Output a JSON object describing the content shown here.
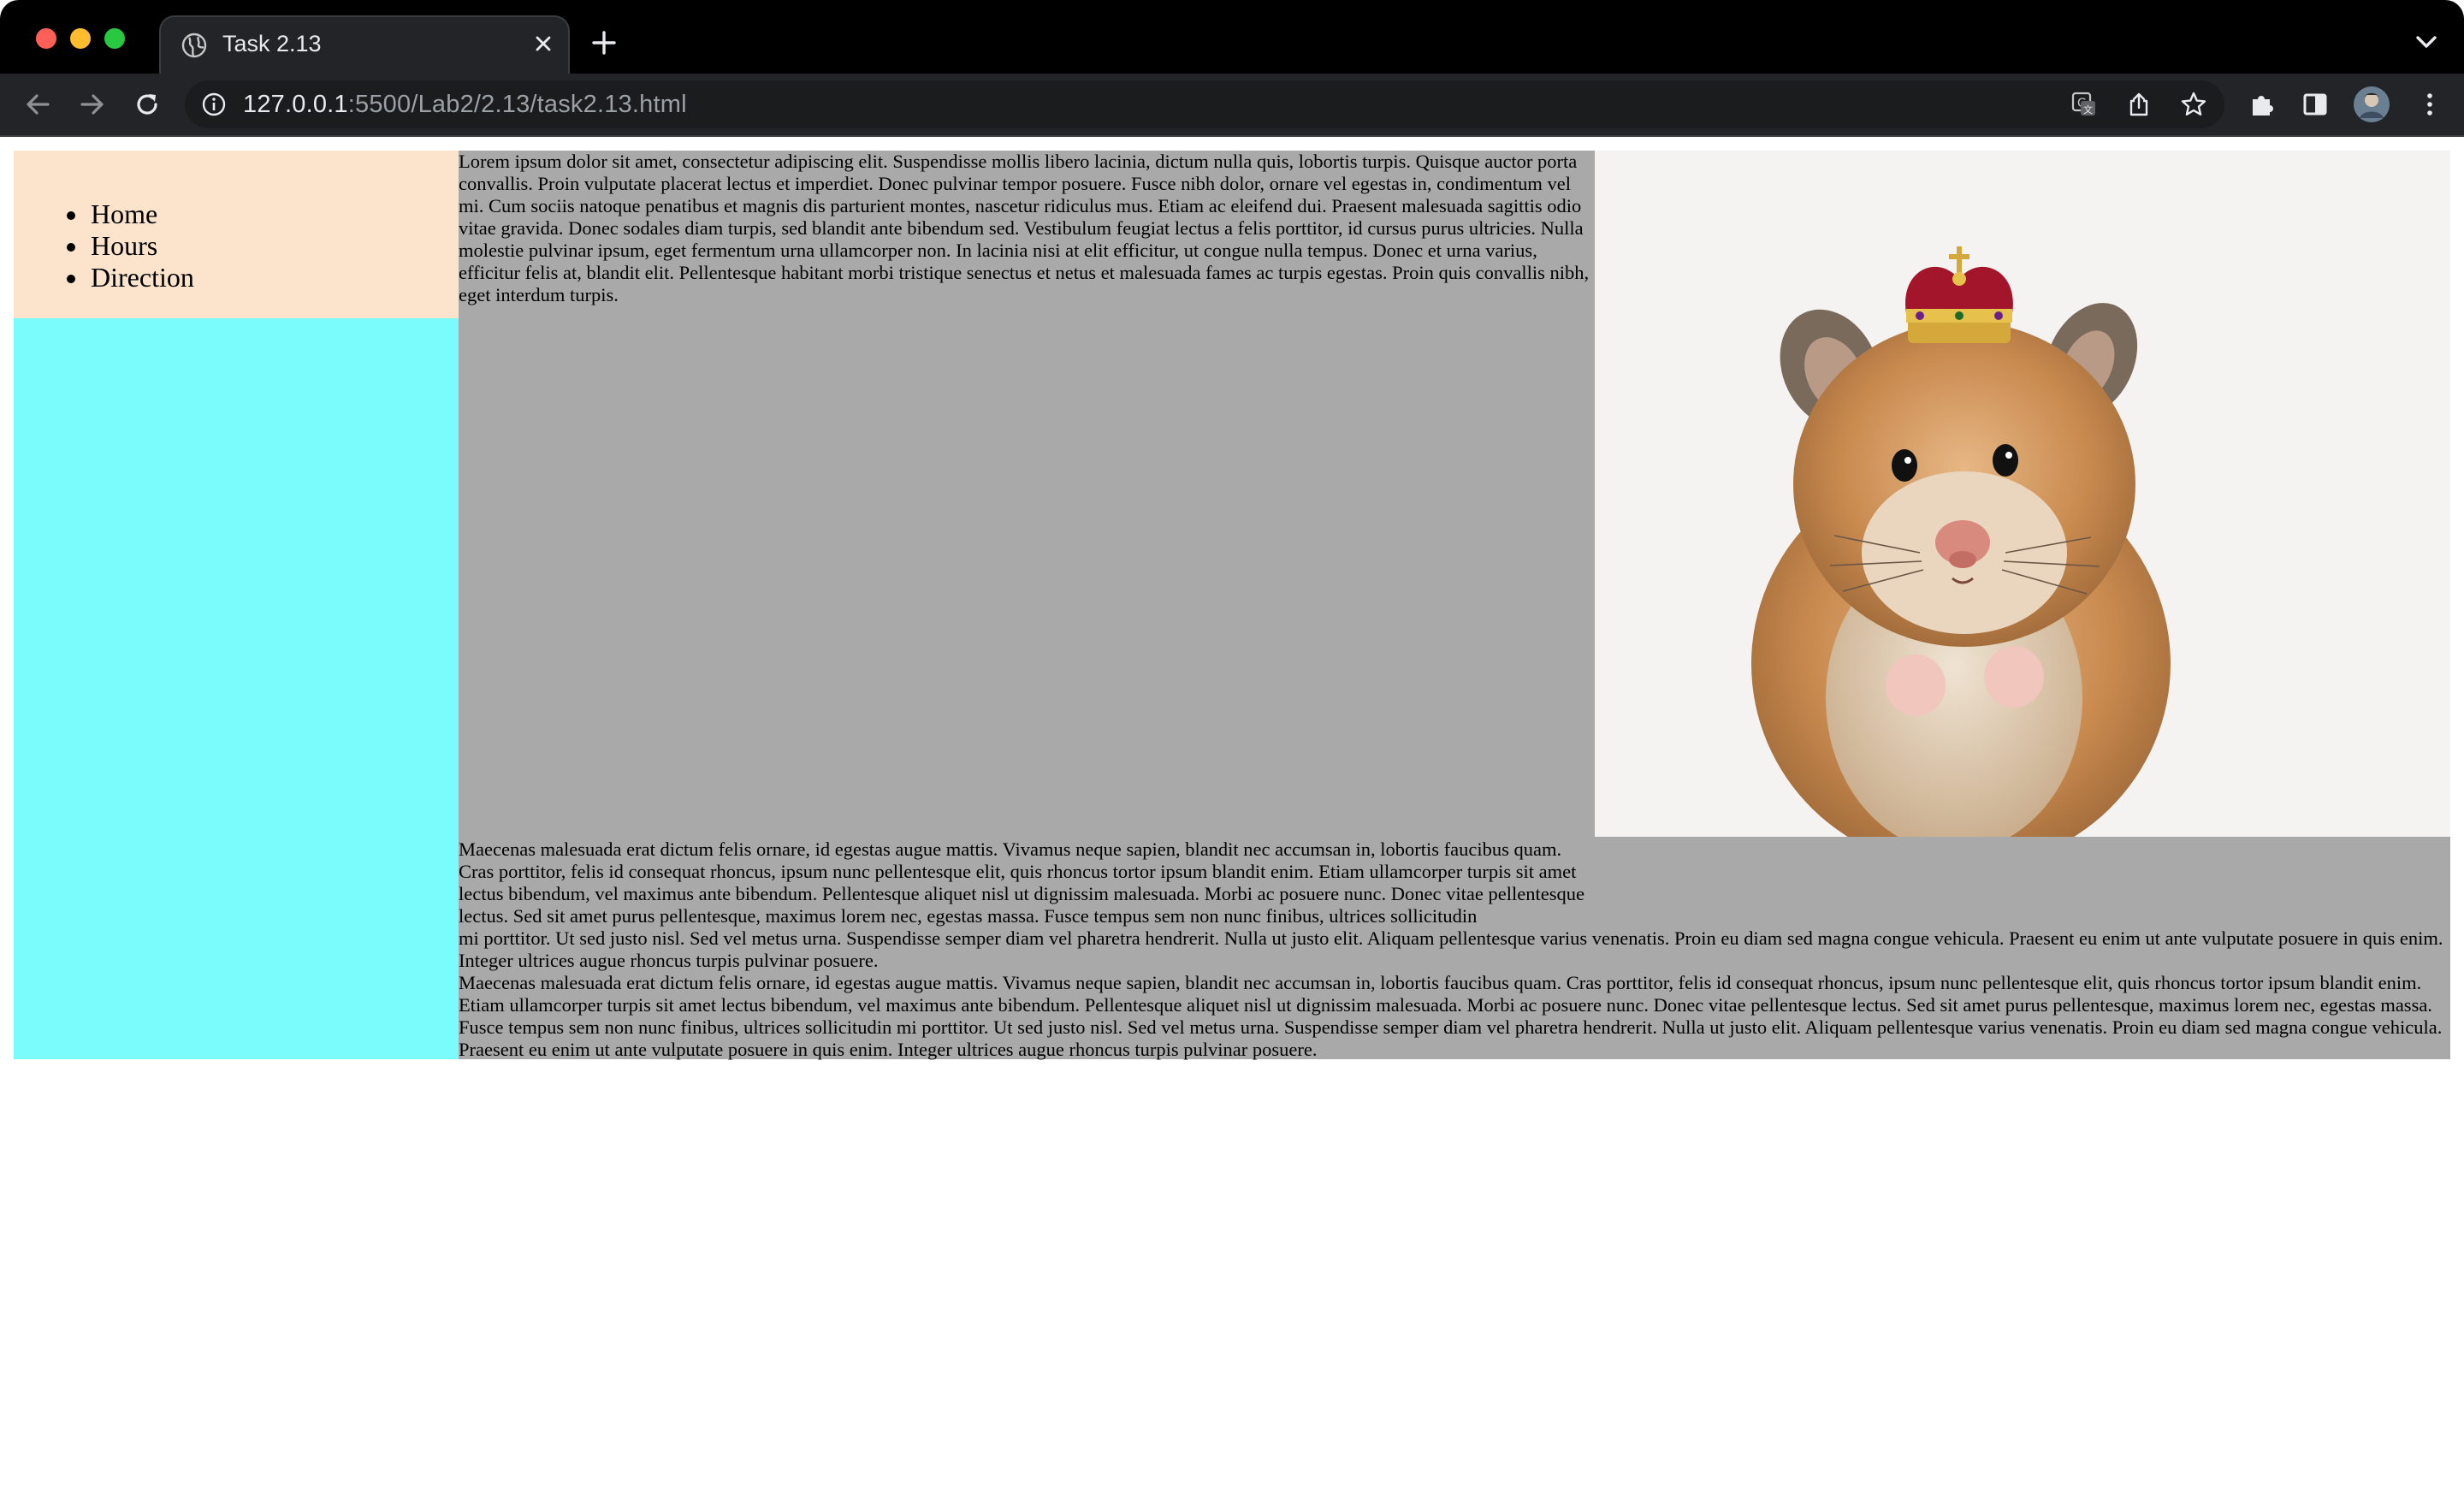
{
  "browser": {
    "tab_title": "Task 2.13",
    "url_host": "127.0.0.1",
    "url_rest": ":5500/Lab2/2.13/task2.13.html"
  },
  "page": {
    "nav": [
      "Home",
      "Hours",
      "Direction"
    ],
    "paragraph_1": "Lorem ipsum dolor sit amet, consectetur adipiscing elit. Suspendisse mollis libero lacinia, dictum nulla quis, lobortis turpis. Quisque auctor porta convallis. Proin vulputate placerat lectus et imperdiet. Donec pulvinar tempor posuere. Fusce nibh dolor, ornare vel egestas in, condimentum vel mi. Cum sociis natoque penatibus et magnis dis parturient montes, nascetur ridiculus mus. Etiam ac eleifend dui. Praesent malesuada sagittis odio vitae gravida. Donec sodales diam turpis, sed blandit ante bibendum sed. Vestibulum feugiat lectus a felis porttitor, id cursus purus ultricies. Nulla molestie pulvinar ipsum, eget fermentum urna ullamcorper non. In lacinia nisi at elit efficitur, ut congue nulla tempus. Donec et urna varius, efficitur felis at, blandit elit. Pellentesque habitant morbi tristique senectus et netus et malesuada fames ac turpis egestas. Proin quis convallis nibh, eget interdum turpis.",
    "paragraph_2_a": "Maecenas malesuada erat dictum felis ornare, id egestas augue mattis. Vivamus neque sapien, blandit nec accumsan in, lobortis faucibus quam. Cras porttitor, felis id consequat rhoncus, ipsum nunc pellentesque elit, quis rhoncus tortor ipsum blandit enim. Etiam ullamcorper turpis sit amet lectus bibendum, vel maximus ante bibendum. Pellentesque aliquet nisl ut dignissim malesuada. Morbi ac posuere nunc. Donec vitae pellentesque lectus. Sed sit amet purus pellentesque, maximus lorem nec, egestas massa. Fusce tempus sem non nunc finibus, ultrices sollicitudin",
    "paragraph_2_b": "mi porttitor. Ut sed justo nisl. Sed vel metus urna. Suspendisse semper diam vel pharetra hendrerit. Nulla ut justo elit. Aliquam pellentesque varius venenatis. Proin eu diam sed magna congue vehicula. Praesent eu enim ut ante vulputate posuere in quis enim. Integer ultrices augue rhoncus turpis pulvinar posuere.",
    "paragraph_3": "Maecenas malesuada erat dictum felis ornare, id egestas augue mattis. Vivamus neque sapien, blandit nec accumsan in, lobortis faucibus quam. Cras porttitor, felis id consequat rhoncus, ipsum nunc pellentesque elit, quis rhoncus tortor ipsum blandit enim. Etiam ullamcorper turpis sit amet lectus bibendum, vel maximus ante bibendum. Pellentesque aliquet nisl ut dignissim malesuada. Morbi ac posuere nunc. Donec vitae pellentesque lectus. Sed sit amet purus pellentesque, maximus lorem nec, egestas massa. Fusce tempus sem non nunc finibus, ultrices sollicitudin mi porttitor. Ut sed justo nisl. Sed vel metus urna. Suspendisse semper diam vel pharetra hendrerit. Nulla ut justo elit. Aliquam pellentesque varius venenatis. Proin eu diam sed magna congue vehicula. Praesent eu enim ut ante vulputate posuere in quis enim. Integer ultrices augue rhoncus turpis pulvinar posuere.",
    "image_subject": "hamster wearing a crown"
  },
  "colors": {
    "nav_bg": "#fbe4cb",
    "sidebar_bg": "#7bfcfc",
    "main_bg": "#a9a9a9"
  },
  "icons": [
    "back-arrow-icon",
    "forward-arrow-icon",
    "reload-icon",
    "site-info-icon",
    "translate-icon",
    "share-icon",
    "bookmark-star-icon",
    "extensions-puzzle-icon",
    "side-panel-icon",
    "profile-avatar",
    "more-menu-icon"
  ]
}
